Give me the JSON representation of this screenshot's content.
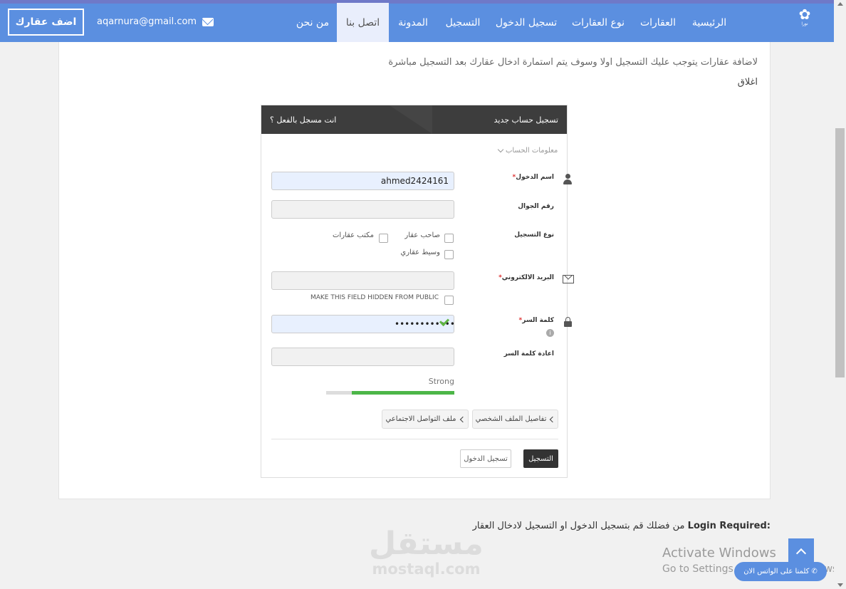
{
  "nav": {
    "add_property": "اضف عقارك",
    "email": "aqarnura@gmail.com",
    "items": [
      "الرئيسية",
      "العقارات",
      "نوع العقارات",
      "تسجيل الدخول",
      "التسجيل",
      "المدونة",
      "اتصل بنا",
      "من نحن"
    ],
    "active": "اتصل بنا",
    "logo_text": "نورا"
  },
  "notice": "لاضافة عقارات يتوجب عليك التسجيل اولا وسوف يتم استمارة ادخال عقارك بعد التسجيل مباشرة",
  "close_label": "اغلاق",
  "form": {
    "header_right": "تسجيل حساب جديد",
    "header_left": "انت مسجل بالفعل ؟",
    "section_select": "معلومات الحساب",
    "username_label": "اسم الدخول",
    "username_value": "ahmed2424161",
    "mobile_label": "رقم الجوال",
    "mobile_value": "",
    "reg_type_label": "نوع التسجيل",
    "reg_types": [
      "صاحب عقار",
      "مكتب عقارات",
      "وسيط عقاري"
    ],
    "email_label": "البريد الالكتروني",
    "email_value": "",
    "hide_field_label": "MAKE THIS FIELD HIDDEN FROM PUBLIC",
    "password_label": "كلمة السر",
    "password_value": "••••••••••••",
    "confirm_label": "اعادة كلمة السر",
    "confirm_value": "",
    "strength_text": "Strong",
    "strength_level": 0.8,
    "tabs": [
      "تفاصيل الملف الشخصي",
      "ملف التواصل الاجتماعي"
    ],
    "register_button": "التسجيل",
    "login_button": "تسجيل الدخول",
    "required_mark": "*"
  },
  "login_required": {
    "bold": "Login Required:",
    "text": " من فضلك قم بتسجيل الدخول او التسجيل لادخال العقار"
  },
  "watermark": {
    "ar": "مستقل",
    "en": "mostaql.com"
  },
  "activate": {
    "title": "Activate Windows",
    "sub": "Go to Settings to activate Windows."
  },
  "whatsapp_label": "كلمنا على الواتس الان",
  "colors": {
    "brand": "#5b8fe0",
    "header_dark": "#3d3d3d",
    "strength": "#4cb648"
  }
}
